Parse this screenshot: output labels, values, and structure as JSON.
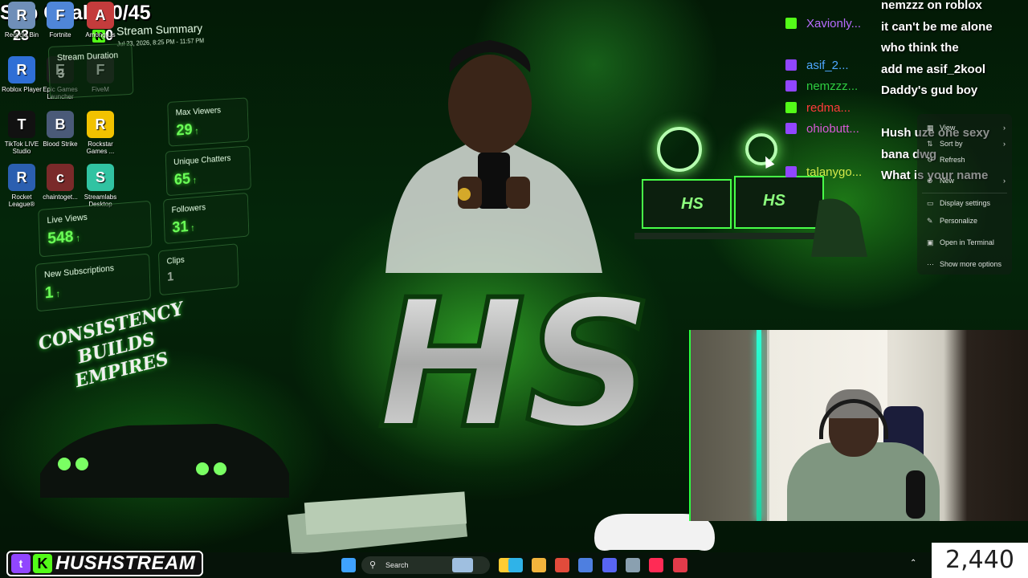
{
  "subgoal": {
    "text": "Sub Goal: 30/45",
    "count_a": "23",
    "count_b": "0"
  },
  "desktop_icons": [
    {
      "label": "Recycle Bin",
      "icon": "recycle-bin-icon",
      "color": "#6f8fb8"
    },
    {
      "label": "Fortnite",
      "icon": "fortnite-icon",
      "color": "#4f86d8"
    },
    {
      "label": "Among Us",
      "icon": "among-us-icon",
      "color": "#c43c3c"
    },
    {
      "label": "Roblox Player",
      "icon": "roblox-icon",
      "color": "#2f6fd6"
    },
    {
      "label": "Epic Games Launcher",
      "icon": "epic-games-icon",
      "color": "#1b1b1b"
    },
    {
      "label": "FiveM",
      "icon": "fivem-icon",
      "color": "#2a2a2a"
    },
    {
      "label": "TikTok LIVE Studio",
      "icon": "tiktok-icon",
      "color": "#111111"
    },
    {
      "label": "Blood Strike",
      "icon": "blood-strike-icon",
      "color": "#4a5a78"
    },
    {
      "label": "Rockstar Games ...",
      "icon": "rockstar-icon",
      "color": "#f2c200"
    },
    {
      "label": "Rocket League®",
      "icon": "rocket-league-icon",
      "color": "#2b5fb0"
    },
    {
      "label": "chaintoget...",
      "icon": "chain-icon",
      "color": "#7a2a2a"
    },
    {
      "label": "Streamlabs Desktop",
      "icon": "streamlabs-icon",
      "color": "#31c3a2"
    }
  ],
  "summary": {
    "title": "Stream Summary",
    "date": "Jul 23, 2026, 8:25 PM - 11:57 PM",
    "duration_label": "Stream Duration",
    "duration_value": "3",
    "stats": [
      {
        "label": "Max Viewers",
        "value": "29",
        "trend": "↑"
      },
      {
        "label": "Unique Chatters",
        "value": "65",
        "trend": "↑"
      },
      {
        "label": "Live Views",
        "value": "548",
        "trend": "↑"
      },
      {
        "label": "Followers",
        "value": "31",
        "trend": "↑"
      },
      {
        "label": "New Subscriptions",
        "value": "1",
        "trend": "↑"
      },
      {
        "label": "Clips",
        "value": "1",
        "trend": ""
      }
    ]
  },
  "slogan": {
    "line1": "CONSISTENCY",
    "line2": "BUILDS",
    "line3": "EMPIRES"
  },
  "chat": {
    "users": [
      {
        "name": "Xavionly...",
        "platform": "kick",
        "color": "#b86bff"
      },
      {
        "name": "asif_2...",
        "platform": "twitch",
        "color": "#4ea7ff"
      },
      {
        "name": "nemzzz...",
        "platform": "twitch",
        "color": "#2ecc40"
      },
      {
        "name": "redma...",
        "platform": "kick",
        "color": "#ff3b3b"
      },
      {
        "name": "ohiobutt...",
        "platform": "twitch",
        "color": "#d65ad6"
      },
      {
        "name": "talanygo...",
        "platform": "twitch",
        "color": "#d4e94a"
      }
    ],
    "messages": [
      "nemzzz on roblox",
      "it can't be me alone",
      "who think the",
      "add me asif_2kool",
      "Daddy's gud boy",
      "",
      "Hush uze one sexy",
      "bana dwg",
      "What is your name"
    ]
  },
  "context_menu": {
    "items": [
      {
        "label": "View",
        "icon": "view-icon",
        "has_sub": true
      },
      {
        "label": "Sort by",
        "icon": "sort-icon",
        "has_sub": true
      },
      {
        "label": "Refresh",
        "icon": "refresh-icon",
        "has_sub": false
      },
      {
        "label": "New",
        "icon": "new-icon",
        "has_sub": true
      },
      {
        "label": "Display settings",
        "icon": "display-icon",
        "has_sub": false
      },
      {
        "label": "Personalize",
        "icon": "personalize-icon",
        "has_sub": false
      },
      {
        "label": "Open in Terminal",
        "icon": "terminal-icon",
        "has_sub": false
      },
      {
        "label": "Show more options",
        "icon": "more-options-icon",
        "has_sub": false
      }
    ]
  },
  "taskbar": {
    "search_placeholder": "Search",
    "apps": [
      {
        "name": "start-icon",
        "color": "#3fa2ff"
      },
      {
        "name": "file-explorer-icon",
        "color": "#ffcc33"
      },
      {
        "name": "weather-icon",
        "color": "#9fbfe0"
      },
      {
        "name": "task-view-icon",
        "color": "#bbbbbb"
      },
      {
        "name": "edge-icon",
        "color": "#2fb3e8"
      },
      {
        "name": "folder-icon",
        "color": "#f2b43c"
      },
      {
        "name": "chrome-icon",
        "color": "#e24b3b"
      },
      {
        "name": "obs-icon",
        "color": "#4e7fe0"
      },
      {
        "name": "discord-icon",
        "color": "#5865f2"
      },
      {
        "name": "steam-icon",
        "color": "#8aa0b0"
      },
      {
        "name": "tiktok-icon",
        "color": "#ff2b55"
      },
      {
        "name": "streamlabs-icon",
        "color": "#e23b4a"
      }
    ]
  },
  "brand": {
    "name": "HUSHSTREAM"
  },
  "counter": "2,440",
  "logo_text": "HS"
}
